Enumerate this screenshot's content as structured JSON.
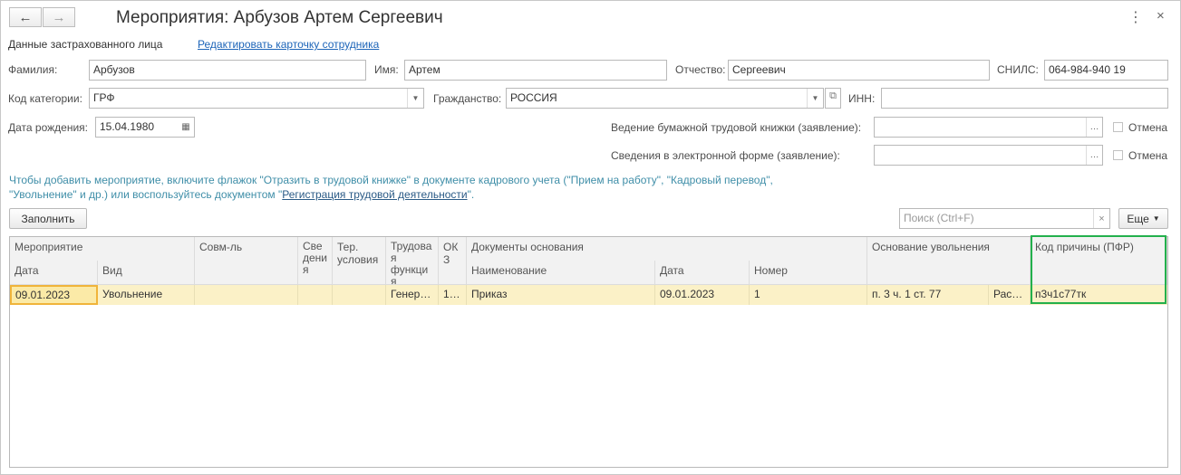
{
  "window": {
    "title": "Мероприятия: Арбузов Артем Сергеевич"
  },
  "nav": {
    "back": "←",
    "forward": "→",
    "more": "⋮",
    "close": "×"
  },
  "person": {
    "section_label": "Данные застрахованного лица",
    "edit_link": "Редактировать карточку сотрудника",
    "surname_label": "Фамилия:",
    "surname": "Арбузов",
    "name_label": "Имя:",
    "name": "Артем",
    "patronymic_label": "Отчество:",
    "patronymic": "Сергеевич",
    "snils_label": "СНИЛС:",
    "snils": "064-984-940 19",
    "category_label": "Код категории:",
    "category": "ГРФ",
    "citizenship_label": "Гражданство:",
    "citizenship": "РОССИЯ",
    "inn_label": "ИНН:",
    "inn": "",
    "birth_label": "Дата рождения:",
    "birth": "15.04.1980",
    "paper_book_label": "Ведение бумажной трудовой книжки (заявление):",
    "paper_book": "",
    "electronic_label": "Сведения в электронной форме (заявление):",
    "electronic": "",
    "cancel_label": "Отмена"
  },
  "hint": {
    "part1": "Чтобы добавить мероприятие, включите флажок \"Отразить в трудовой книжке\" в документе кадрового учета (\"Прием на работу\", \"Кадровый перевод\",",
    "part2": "\"Увольнение\" и др.) или воспользуйтесь документом \"",
    "link": "Регистрация трудовой деятельности",
    "part3": "\"."
  },
  "toolbar": {
    "fill_button": "Заполнить",
    "search_placeholder": "Поиск (Ctrl+F)",
    "more_button": "Еще"
  },
  "table": {
    "headers": {
      "event": "Мероприятие",
      "date": "Дата",
      "kind": "Вид",
      "part_time": "Совм-ль",
      "info": "Све\nдени\nя",
      "terr": "Тер.\nусловия",
      "labor_func": "Трудова\nя\nфункци\nя",
      "okz": "ОК\nЗ",
      "docs": "Документы основания",
      "doc_name": "Наименование",
      "doc_date": "Дата",
      "doc_number": "Номер",
      "dismissal": "Основание увольнения",
      "reason_code": "Код причины (ПФР)"
    },
    "rows": [
      {
        "date": "09.01.2023",
        "kind": "Увольнение",
        "part_time": "",
        "info": "",
        "terr": "",
        "labor_func": "Генер…",
        "okz": "1…",
        "doc_name": "Приказ",
        "doc_date": "09.01.2023",
        "doc_number": "1",
        "dismissal": "п. 3 ч. 1 ст. 77",
        "dismissal_extra": "Рас…",
        "reason_code": "п3ч1с77тк"
      }
    ]
  }
}
